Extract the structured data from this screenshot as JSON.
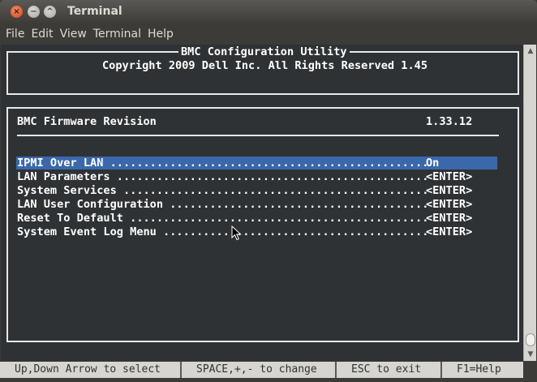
{
  "window": {
    "title": "Terminal",
    "buttons": {
      "close": "×",
      "minimize": "−",
      "maximize": "^"
    }
  },
  "menubar": [
    "File",
    "Edit",
    "View",
    "Terminal",
    "Help"
  ],
  "bmc": {
    "header_title": "BMC Configuration Utility",
    "copyright": "Copyright 2009 Dell Inc. All Rights Reserved 1.45",
    "firmware_label": "BMC Firmware Revision",
    "firmware_value": "1.33.12",
    "items": [
      {
        "label": "IPMI Over LAN ................................................",
        "value": "On",
        "selected": true
      },
      {
        "label": "LAN Parameters ...............................................",
        "value": "<ENTER>",
        "selected": false
      },
      {
        "label": "System Services ..............................................",
        "value": "<ENTER>",
        "selected": false
      },
      {
        "label": "LAN User Configuration .......................................",
        "value": "<ENTER>",
        "selected": false
      },
      {
        "label": "Reset To Default .............................................",
        "value": "<ENTER>",
        "selected": false
      },
      {
        "label": "System Event Log Menu ........................................",
        "value": "<ENTER>",
        "selected": false
      }
    ]
  },
  "statusbar": [
    "Up,Down Arrow to select",
    "SPACE,+,- to change",
    "ESC to exit",
    "F1=Help"
  ],
  "colors": {
    "terminal_bg": "#2f3234",
    "selection": "#3a68aa",
    "chrome": "#3c3b37"
  }
}
